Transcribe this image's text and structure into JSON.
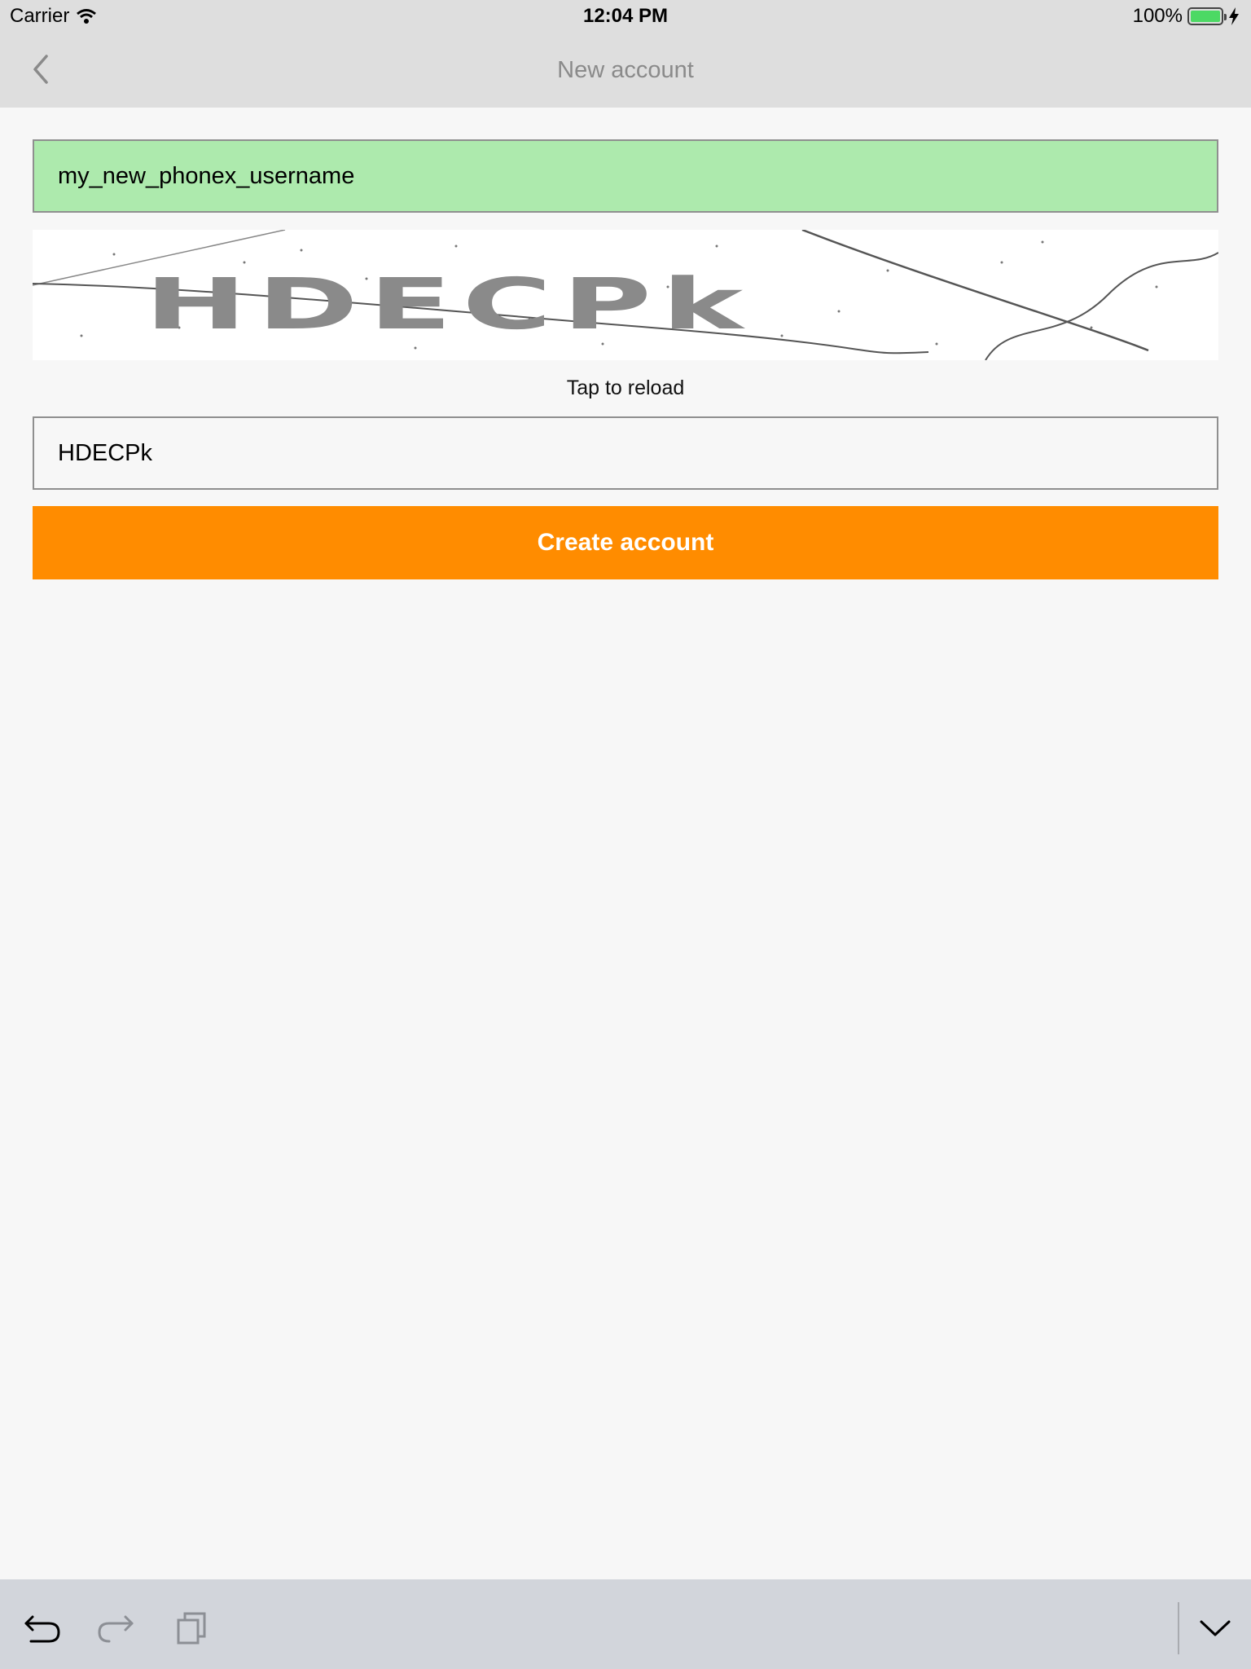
{
  "status_bar": {
    "carrier": "Carrier",
    "time": "12:04 PM",
    "battery": "100%",
    "battery_color": "#4cd964"
  },
  "nav": {
    "back_icon": "chevron-left-icon",
    "title": "New account"
  },
  "form": {
    "username_value": "my_new_phonex_username",
    "username_bg": "#adeaad",
    "captcha_text": "HDECPk",
    "reload_label": "Tap to reload",
    "captcha_value": "HDECPk",
    "create_button_label": "Create account",
    "accent": "#ff8c00"
  },
  "keyboard_bar": {
    "icons": [
      "undo-icon",
      "redo-icon",
      "paste-icon",
      "dismiss-keyboard-icon"
    ]
  }
}
